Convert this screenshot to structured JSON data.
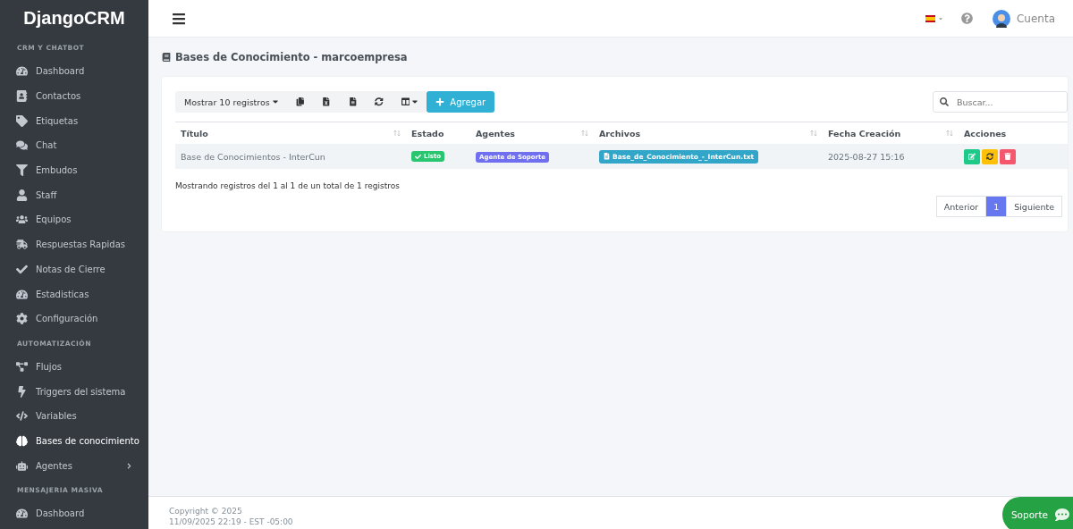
{
  "brand": "DjangoCRM",
  "sidebar": {
    "items": [
      {
        "kind": "header",
        "label": "CRM Y CHATBOT"
      },
      {
        "kind": "item",
        "label": "Dashboard",
        "selected": false
      },
      {
        "kind": "item",
        "label": "Contactos",
        "selected": false
      },
      {
        "kind": "item",
        "label": "Etiquetas",
        "selected": false
      },
      {
        "kind": "item",
        "label": "Chat",
        "selected": false
      },
      {
        "kind": "item",
        "label": "Embudos",
        "selected": false
      },
      {
        "kind": "item",
        "label": "Staff",
        "selected": false
      },
      {
        "kind": "item",
        "label": "Equipos",
        "selected": false
      },
      {
        "kind": "item",
        "label": "Respuestas Rapidas",
        "selected": false
      },
      {
        "kind": "item",
        "label": "Notas de Cierre",
        "selected": false
      },
      {
        "kind": "item",
        "label": "Estadisticas",
        "selected": false
      },
      {
        "kind": "item",
        "label": "Configuración",
        "selected": false
      },
      {
        "kind": "header",
        "label": "AUTOMATIZACIÓN"
      },
      {
        "kind": "item",
        "label": "Flujos",
        "selected": false
      },
      {
        "kind": "item",
        "label": "Triggers del sistema",
        "selected": false
      },
      {
        "kind": "item",
        "label": "Variables",
        "selected": false
      },
      {
        "kind": "item",
        "label": "Bases de conocimiento",
        "selected": true
      },
      {
        "kind": "item",
        "label": "Agentes",
        "selected": false,
        "submenu": true
      },
      {
        "kind": "header",
        "label": "MENSAJERIA MASIVA"
      },
      {
        "kind": "item",
        "label": "Dashboard",
        "selected": false
      }
    ]
  },
  "topbar": {
    "account": "Cuenta"
  },
  "page_title": "Bases de Conocimiento - marcoempresa",
  "toolbar": {
    "page_length": "Mostrar 10 registros",
    "add": "Agregar",
    "search_placeholder": "Buscar..."
  },
  "table": {
    "columns": [
      {
        "label": "Título",
        "sortable": true
      },
      {
        "label": "Estado",
        "sortable": false
      },
      {
        "label": "Agentes",
        "sortable": true
      },
      {
        "label": "Archivos",
        "sortable": true
      },
      {
        "label": "Fecha Creación",
        "sortable": true
      },
      {
        "label": "Acciones",
        "sortable": false
      }
    ],
    "rows": [
      {
        "title": "Base de Conocimientos - InterCun",
        "status": "Listo",
        "agent": "Agente de Soporte",
        "file": "Base_de_Conocimiento_-_InterCun.txt",
        "created": "2025-08-27 15:16"
      }
    ]
  },
  "info": "Mostrando registros del 1 al 1 de un total de 1 registros",
  "pagination": [
    {
      "label": "Anterior",
      "selected": false
    },
    {
      "label": "1",
      "selected": true
    },
    {
      "label": "Siguiente",
      "selected": false
    }
  ],
  "footer": {
    "copyright": "Copyright © 2025",
    "timestamp": "11/09/2025 22:19 - EST -05:00"
  },
  "chat_button": "Soporte"
}
